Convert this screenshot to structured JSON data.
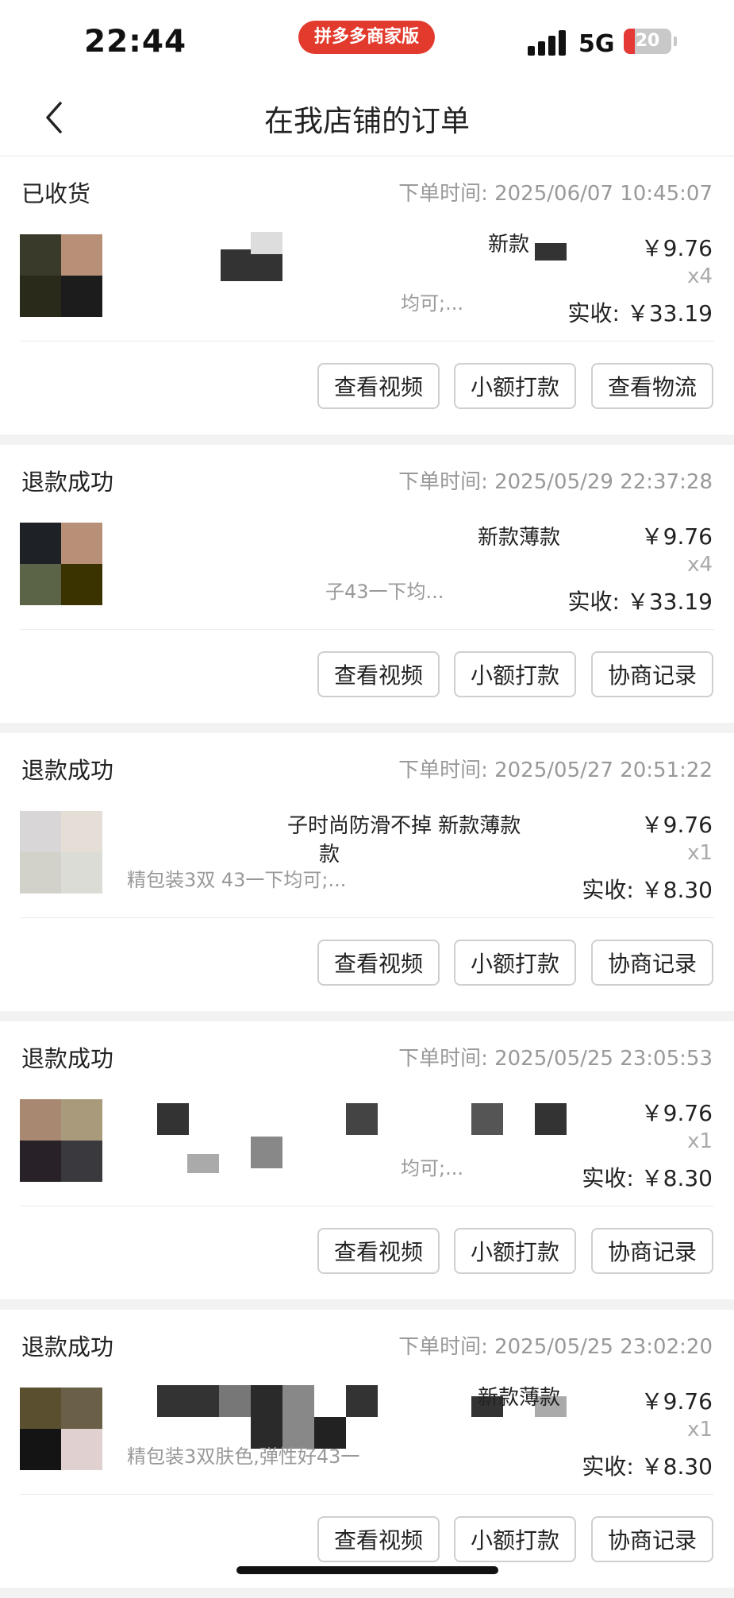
{
  "status_bar": {
    "time": "22:44",
    "app_badge": "拼多多商家版",
    "network": "5G",
    "battery": "20"
  },
  "nav": {
    "title": "在我店铺的订单",
    "back_icon": "chevron-left-icon"
  },
  "buttons": {
    "view_video": "查看视频",
    "small_payment": "小额打款",
    "view_logistics": "查看物流",
    "negotiation_record": "协商记录"
  },
  "time_label": "下单时间: ",
  "orders": [
    {
      "status": "已收货",
      "order_time": "2025/06/07 10:45:07",
      "title_fragment": "新款",
      "spec_fragment": "均可;...",
      "price": "￥9.76",
      "quantity": "x4",
      "paid": "实收: ￥33.19",
      "third_button": "查看物流"
    },
    {
      "status": "退款成功",
      "order_time": "2025/05/29 22:37:28",
      "title_fragment": "新款薄款",
      "spec_fragment": "子43一下均...",
      "price": "￥9.76",
      "quantity": "x4",
      "paid": "实收: ￥33.19",
      "third_button": "协商记录"
    },
    {
      "status": "退款成功",
      "order_time": "2025/05/27 20:51:22",
      "title_fragment": "子时尚防滑不掉 新款薄款",
      "title_fragment_2": "款",
      "spec_fragment": "精包装3双 43一下均可;...",
      "price": "￥9.76",
      "quantity": "x1",
      "paid": "实收: ￥8.30",
      "third_button": "协商记录"
    },
    {
      "status": "退款成功",
      "order_time": "2025/05/25 23:05:53",
      "title_fragment": "",
      "spec_fragment": "均可;...",
      "price": "￥9.76",
      "quantity": "x1",
      "paid": "实收: ￥8.30",
      "third_button": "协商记录"
    },
    {
      "status": "退款成功",
      "order_time": "2025/05/25 23:02:20",
      "title_fragment": "新款薄款",
      "spec_fragment": "精包装3双肤色,弹性好43一",
      "price": "￥9.76",
      "quantity": "x1",
      "paid": "实收: ￥8.30",
      "third_button": "协商记录"
    }
  ],
  "colors": {
    "accent_red": "#e23b2e",
    "card_bg": "#ffffff",
    "page_bg": "#f2f2f2",
    "muted_text": "#999999"
  }
}
